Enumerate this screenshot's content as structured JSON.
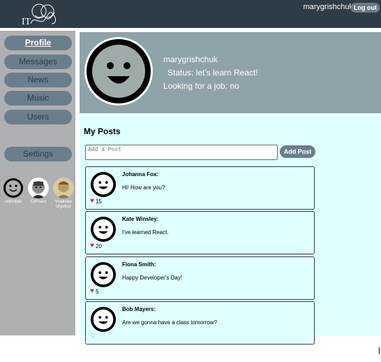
{
  "header": {
    "logo_text": "IT",
    "login_name": "marygrishchuk",
    "logout_label": "Log out"
  },
  "sidebar": {
    "items": [
      {
        "label": "Profile",
        "active": true
      },
      {
        "label": "Messages"
      },
      {
        "label": "News"
      },
      {
        "label": "Music"
      },
      {
        "label": "Users"
      },
      {
        "label": "Settings"
      }
    ],
    "friends": [
      {
        "name": "stillminsk",
        "avatar": "smiley-icon"
      },
      {
        "name": "ClIPsast",
        "avatar": "photo-avatar"
      },
      {
        "name": "Vladislav Uryukov",
        "avatar": "photo-avatar"
      }
    ]
  },
  "profile": {
    "name": "marygrishchuk",
    "status": "Status: let's learn React!",
    "job": "Looking for a job: no"
  },
  "posts": {
    "title": "My Posts",
    "input_placeholder": "Add a Post",
    "add_label": "Add Post",
    "items": [
      {
        "author": "Johanna Fox:",
        "text": "Hi! How are you?",
        "likes": "15"
      },
      {
        "author": "Kate Winsley:",
        "text": "I've learned React.",
        "likes": "20"
      },
      {
        "author": "Fiona Smith:",
        "text": "Happy Developer's Day!",
        "likes": "5"
      },
      {
        "author": "Bob Mayers:",
        "text": "Are we gonna have a class tomorrow?",
        "likes": ""
      }
    ]
  },
  "colors": {
    "header": "#2e3c47",
    "sidebar": "#aeb0b2",
    "content": "#e0ffff",
    "banner": "#8ea3a8",
    "button": "#6b7e8b",
    "heart": "#d92b3a"
  }
}
